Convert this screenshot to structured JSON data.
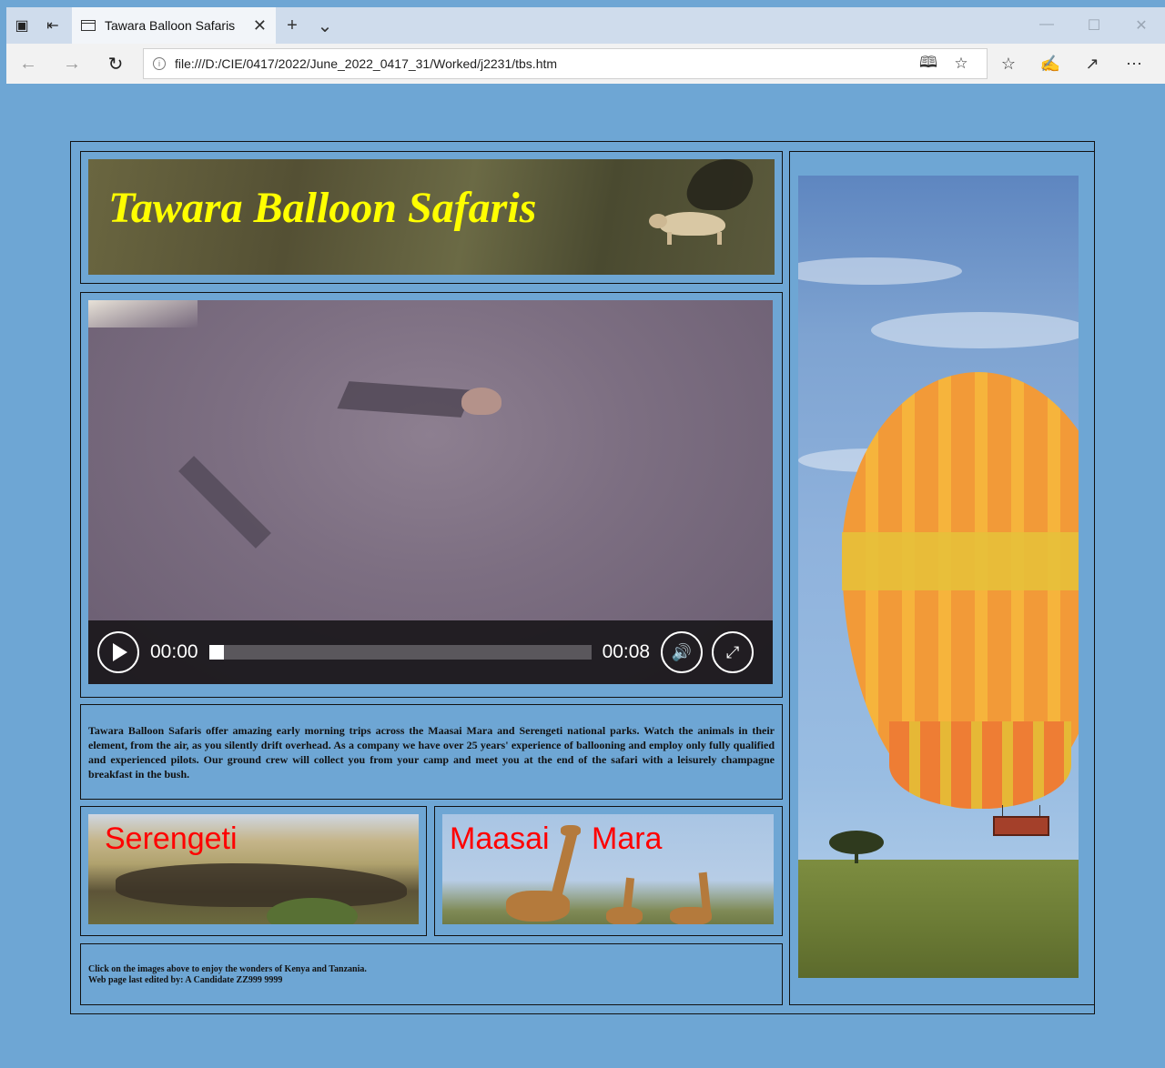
{
  "browser": {
    "tab_title": "Tawara Balloon Safaris",
    "url": "file:///D:/CIE/0417/2022/June_2022_0417_31/Worked/j2231/tbs.htm"
  },
  "page": {
    "banner_title": "Tawara Balloon Safaris",
    "video": {
      "current_time": "00:00",
      "duration": "00:08",
      "progress": 0
    },
    "description": "Tawara Balloon Safaris offer amazing early morning trips across the Maasai Mara and Serengeti national parks. Watch the animals in their element, from the air, as you silently drift overhead. As a company we have over 25 years' experience of ballooning and employ only fully qualified and experienced pilots. Our ground crew will collect you from your camp and meet you at the end of the safari with a leisurely champagne breakfast in the bush.",
    "link_serengeti": "Serengeti",
    "link_maasai_left": "Maasai",
    "link_maasai_right": "Mara",
    "footer_line1": "Click on the images above to enjoy the wonders of Kenya and Tanzania.",
    "footer_line2": "Web page last edited by: A Candidate ZZ999 9999"
  },
  "colors": {
    "page_background": "#6ea6d4",
    "banner_title": "#ffff00",
    "thumb_label": "#ff0000"
  }
}
